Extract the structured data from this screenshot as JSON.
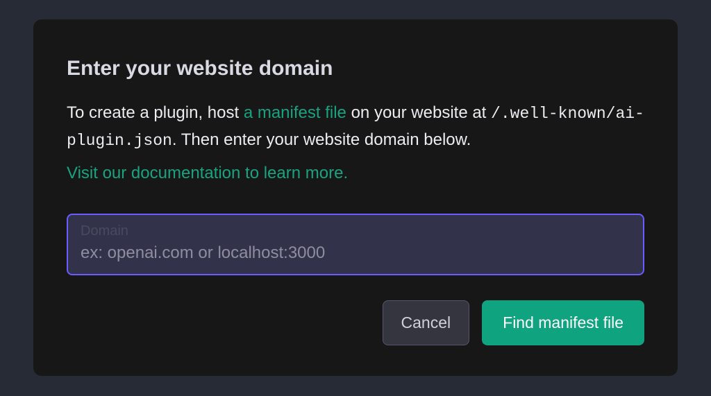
{
  "dialog": {
    "title": "Enter your website domain",
    "description_pre": "To create a plugin, host ",
    "manifest_link_text": "a manifest file",
    "description_mid": " on your website at ",
    "code_path": "/.well-known/ai-plugin.json",
    "description_post": ". Then enter your website domain below.",
    "doc_link_text": "Visit our documentation to learn more.",
    "input_label": "Domain",
    "input_placeholder": "ex: openai.com or localhost:3000",
    "input_value": "",
    "cancel_label": "Cancel",
    "submit_label": "Find manifest file"
  },
  "colors": {
    "accent_green": "#10a37f",
    "input_border": "#6a5cff",
    "dialog_bg": "#171717",
    "page_bg": "#262b36"
  }
}
